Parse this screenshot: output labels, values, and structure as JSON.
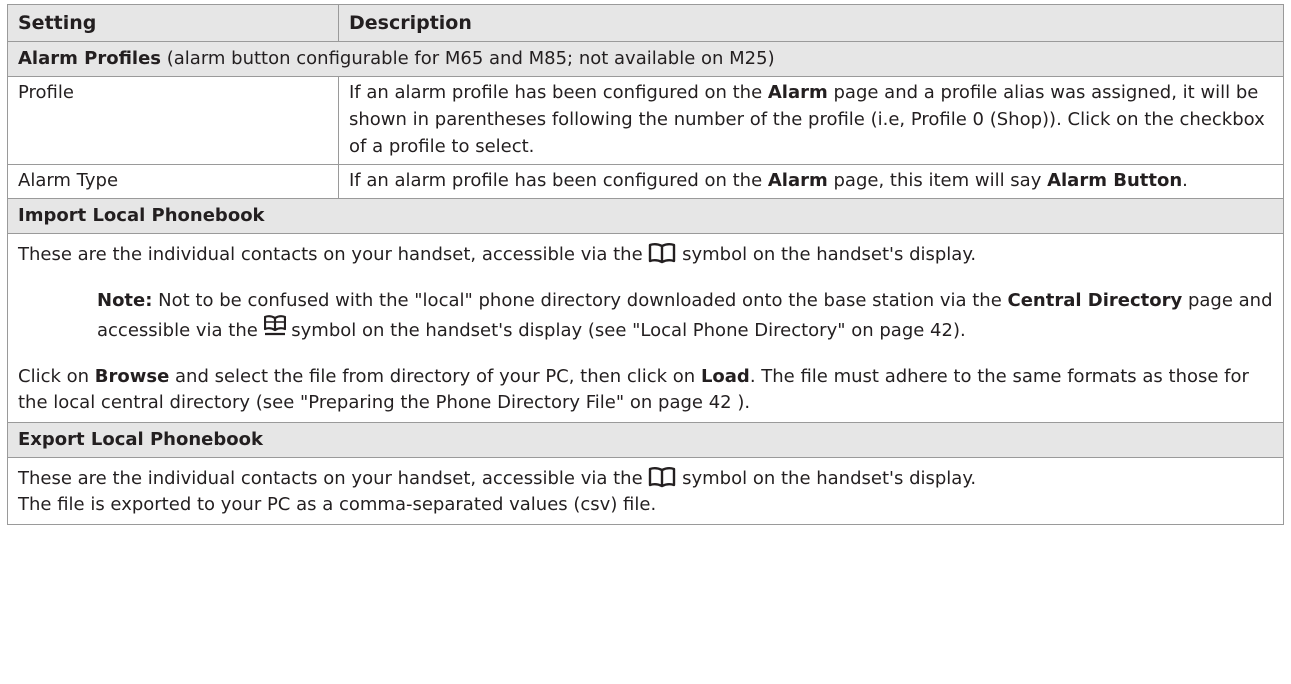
{
  "table": {
    "header": {
      "setting": "Setting",
      "description": "Description"
    },
    "alarm_profiles": {
      "title": "Alarm Profiles",
      "note": " (alarm button configurable for M65 and M85; not available on M25)"
    },
    "rows": [
      {
        "setting": "Profile",
        "desc_1": "If an alarm profile has been configured on the ",
        "desc_bold_1": "Alarm",
        "desc_2": " page and a profile alias was assigned, it will be shown in parentheses following the number of the profile (i.e, Profile 0 (Shop)).  Click on the checkbox of a profile to select."
      },
      {
        "setting": "Alarm Type",
        "desc_1": "If an alarm profile has been configured on the ",
        "desc_bold_1": "Alarm",
        "desc_2": " page, this item will say ",
        "desc_bold_2": "Alarm Button",
        "desc_3": "."
      }
    ],
    "import": {
      "title": "Import Local Phonebook",
      "p1_a": "These are the individual contacts on your handset, accessible via the ",
      "p1_b": " symbol on the handset's display.",
      "note_label": "Note:",
      "note_a": "  Not to be confused with the \"local\" phone directory downloaded onto the base station via the ",
      "note_bold": "Central Directory",
      "note_b": " page and accessible via the ",
      "note_c": " symbol on the handset's display (see \"Local Phone Directory\" on page 42).",
      "p2_a": "Click on ",
      "p2_bold_1": "Browse",
      "p2_b": " and select the file from directory of your PC, then click on ",
      "p2_bold_2": "Load",
      "p2_c": ".  The file must adhere to the same formats as those for the local central directory (see \"Preparing the Phone Directory File\" on page 42 )."
    },
    "export": {
      "title": "Export Local Phonebook",
      "p1_a": "These are the individual contacts on your handset, accessible via the ",
      "p1_b": " symbol on the handset's display.",
      "p2": "The file is exported to your PC as a comma-separated values (csv) file."
    }
  },
  "icons": {
    "book": "open-book-icon",
    "directory": "directory-book-icon"
  }
}
